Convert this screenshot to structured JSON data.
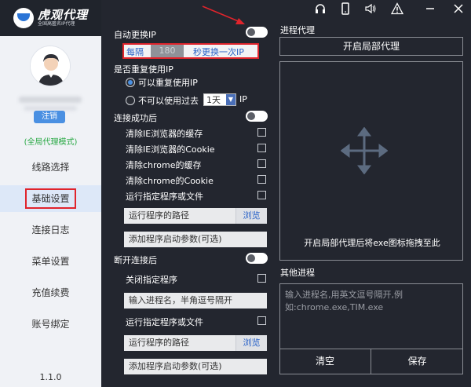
{
  "brand": {
    "title": "虎观代理",
    "subtitle": "全国高匿名IP代理"
  },
  "sidebar": {
    "logout": "注销",
    "mode": "(全局代理模式)",
    "items": [
      {
        "label": "线路选择"
      },
      {
        "label": "基础设置",
        "active": true
      },
      {
        "label": "连接日志"
      },
      {
        "label": "菜单设置"
      },
      {
        "label": "充值续费"
      },
      {
        "label": "账号绑定"
      }
    ],
    "version": "1.1.0"
  },
  "topbar": {
    "icons": [
      "headset-icon",
      "phone-icon",
      "speaker-icon",
      "warning-icon",
      "minimize-icon",
      "close-icon"
    ]
  },
  "settings": {
    "auto_switch_label": "自动更换IP",
    "interval_prefix": "每隔",
    "interval_value": "180",
    "interval_suffix": "秒更换一次IP",
    "reuse_label": "是否重复使用IP",
    "reuse_yes": "可以重复使用IP",
    "reuse_no": "不可以使用过去",
    "days_value": "1天",
    "days_suffix": "IP",
    "on_connect_label": "连接成功后",
    "on_connect_options": [
      "清除IE浏览器的缓存",
      "清除IE浏览器的Cookie",
      "清除chrome的缓存",
      "清除chrome的Cookie",
      "运行指定程序或文件"
    ],
    "program_path_placeholder": "运行程序的路径",
    "browse_label": "浏览",
    "args_placeholder": "添加程序启动参数(可选)",
    "on_disconnect_label": "断开连接后",
    "close_program_label": "关闭指定程序",
    "process_names_placeholder": "输入进程名，半角逗号隔开",
    "run_program_label": "运行指定程序或文件",
    "program_path_placeholder2": "运行程序的路径",
    "browse_label2": "浏览",
    "args_placeholder2": "添加程序启动参数(可选)"
  },
  "process_proxy": {
    "title": "进程代理",
    "open_local_button": "开启局部代理",
    "drop_hint": "开启局部代理后将exe图标拖拽至此",
    "other_title": "其他进程",
    "other_placeholder": "输入进程名,用英文逗号隔开,例如:chrome.exe,TIM.exe",
    "clear_button": "清空",
    "save_button": "保存"
  },
  "colors": {
    "accent": "#4a90e2",
    "panel_bg": "#23262f",
    "highlight": "#e0242c",
    "mode_green": "#27a843"
  }
}
